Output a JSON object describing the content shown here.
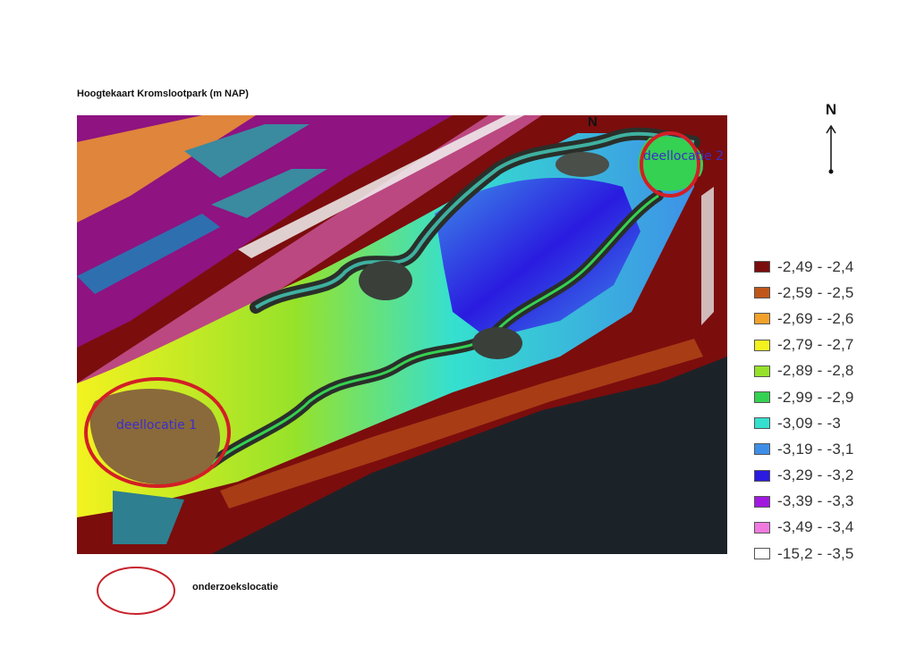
{
  "title": "Hoogtekaart Kromslootpark (m NAP)",
  "north_label": "N",
  "map": {
    "north_marker": "N",
    "location_labels": [
      "deellocatie 1",
      "deellocatie 2"
    ],
    "highlight_color": "#d21f26"
  },
  "legend": [
    {
      "label": "-2,49 - -2,4",
      "color": "#7b0d0d"
    },
    {
      "label": "-2,59 - -2,5",
      "color": "#c0561a"
    },
    {
      "label": "-2,69 - -2,6",
      "color": "#f2a22a"
    },
    {
      "label": "-2,79 - -2,7",
      "color": "#f3f21f"
    },
    {
      "label": "-2,89 - -2,8",
      "color": "#96e22a"
    },
    {
      "label": "-2,99 - -2,9",
      "color": "#35d152"
    },
    {
      "label": "-3,09 - -3",
      "color": "#35e0cf"
    },
    {
      "label": "-3,19 - -3,1",
      "color": "#3e8ee8"
    },
    {
      "label": "-3,29 - -3,2",
      "color": "#2a1be0"
    },
    {
      "label": "-3,39 - -3,3",
      "color": "#a119e0"
    },
    {
      "label": "-3,49 - -3,4",
      "color": "#f07ae0"
    },
    {
      "label": "-15,2 - -3,5",
      "color": "#ffffff"
    }
  ],
  "key": {
    "label": "onderzoekslocatie",
    "color": "#c8212a"
  }
}
